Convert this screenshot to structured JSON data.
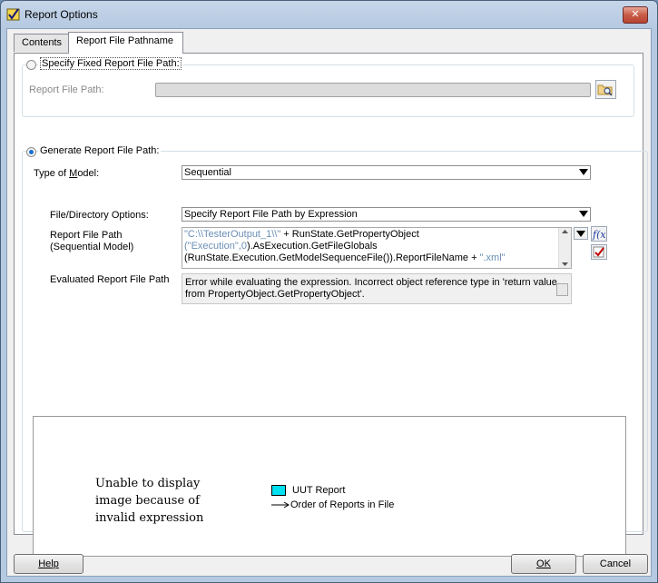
{
  "window": {
    "title": "Report Options",
    "close_label": "✕"
  },
  "tabs": [
    {
      "label": "Contents",
      "active": false
    },
    {
      "label": "Report File Pathname",
      "active": true
    }
  ],
  "fixed_path_group": {
    "radio_label": "Specify Fixed Report File Path:",
    "checked": false,
    "path_label": "Report File Path:",
    "path_value": "",
    "browse_icon": "folder-search-icon"
  },
  "generate_group": {
    "radio_label": "Generate Report File Path:",
    "checked": true,
    "model_type_label": "Type of Model:",
    "model_type_value": "Sequential",
    "file_dir_options_label": "File/Directory Options:",
    "file_dir_options_value": "Specify Report File Path by Expression",
    "report_path_label_1": "Report File Path",
    "report_path_label_2": "(Sequential Model)",
    "expression": {
      "line1_str": "\"C:\\\\TesterOutput_1\\\\\"",
      "line1_rest": " + RunState.GetPropertyObject",
      "line2_open": "(",
      "line2_str": "\"Execution\"",
      "line2_num": ",0",
      "line2_rest": ").AsExecution.GetFileGlobals",
      "line3_rest": "(RunState.Execution.GetModelSequenceFile()).ReportFileName + ",
      "line3_str": "\".xml\""
    },
    "expr_icons": [
      "dropdown-arrow-icon",
      "function-browser-icon",
      "check-expression-icon"
    ],
    "evaluated_label": "Evaluated Report File Path",
    "evaluated_line1": "Error while evaluating the expression. Incorrect object reference type in 'return value",
    "evaluated_line2": "from PropertyObject.GetPropertyObject'."
  },
  "preview": {
    "message_line1": "Unable to display",
    "message_line2": "image because of",
    "message_line3": "invalid expression",
    "legend_uut": "UUT Report",
    "legend_order": "Order of Reports in File",
    "uut_color": "#00e0f0"
  },
  "buttons": {
    "help": "Help",
    "ok": "OK",
    "cancel": "Cancel"
  }
}
